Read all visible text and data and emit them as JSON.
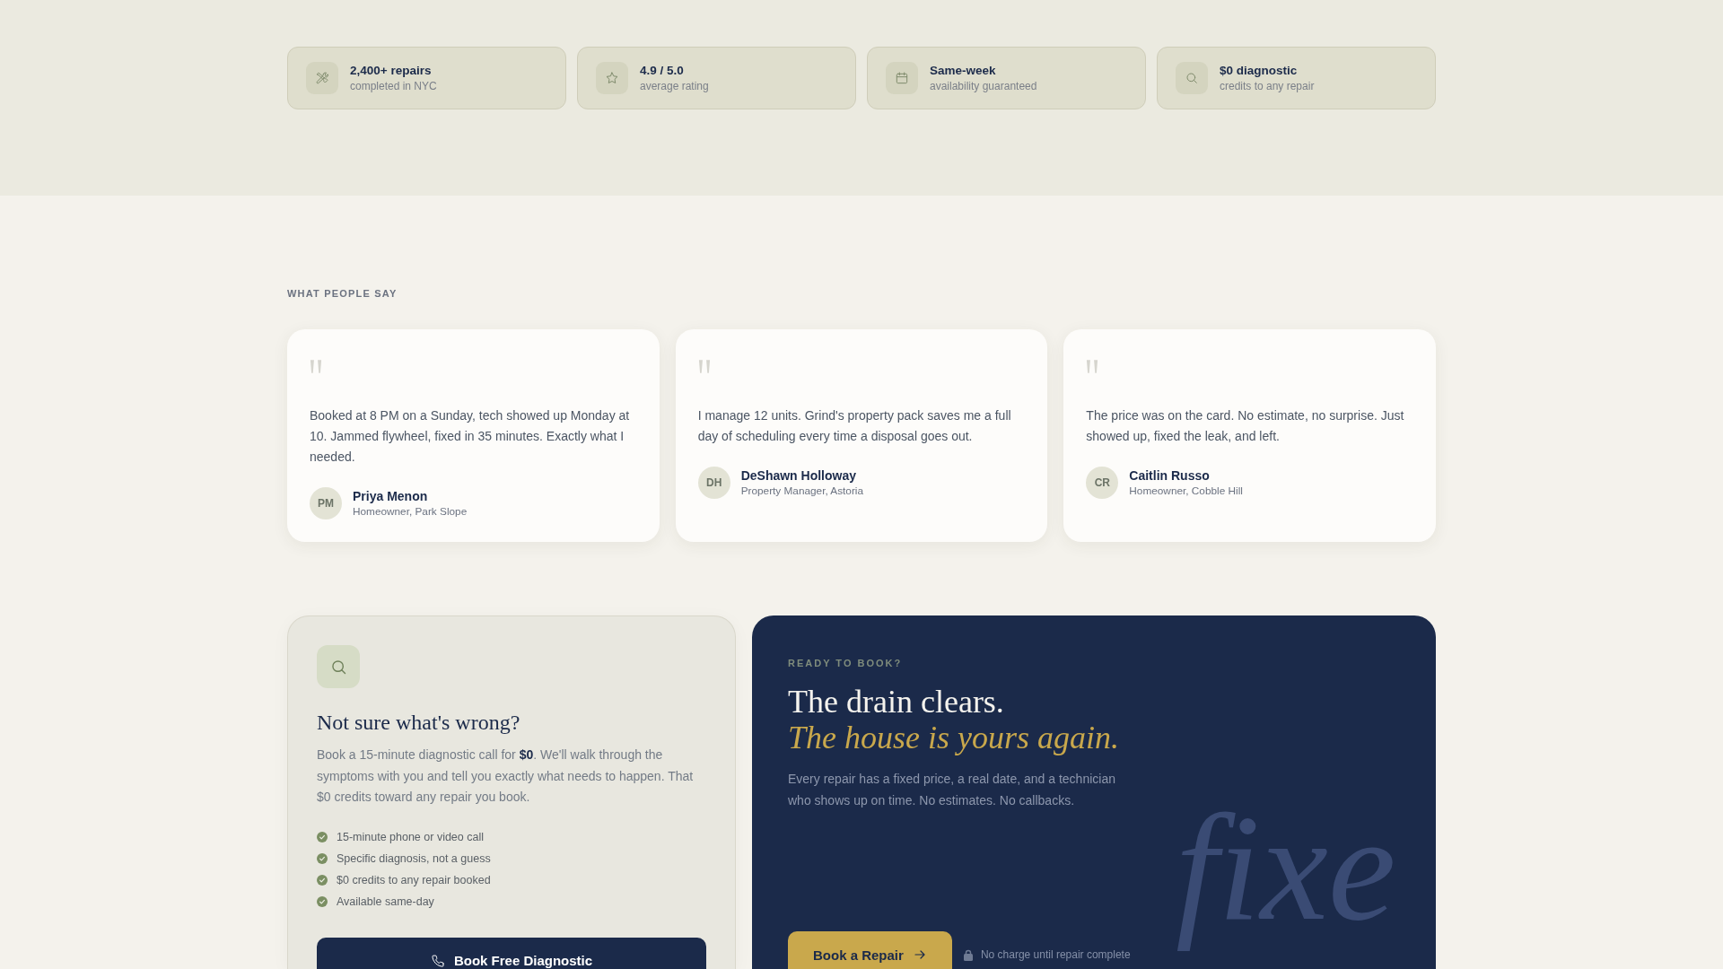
{
  "stats": [
    {
      "title": "2,400+ repairs",
      "caption": "completed in NYC"
    },
    {
      "title": "4.9 / 5.0",
      "caption": "average rating"
    },
    {
      "title": "Same-week",
      "caption": "availability guaranteed"
    },
    {
      "title": "$0 diagnostic",
      "caption": "credits to any repair"
    }
  ],
  "testimonials": {
    "label": "WHAT PEOPLE SAY",
    "items": [
      {
        "quote": "Booked at 8 PM on a Sunday, tech showed up Monday at 10. Jammed flywheel, fixed in 35 minutes. Exactly what I needed.",
        "initials": "PM",
        "name": "Priya Menon",
        "role": "Homeowner, Park Slope"
      },
      {
        "quote": "I manage 12 units. Grind's property pack saves me a full day of scheduling every time a disposal goes out.",
        "initials": "DH",
        "name": "DeShawn Holloway",
        "role": "Property Manager, Astoria"
      },
      {
        "quote": "The price was on the card. No estimate, no surprise. Just showed up, fixed the leak, and left.",
        "initials": "CR",
        "name": "Caitlin Russo",
        "role": "Homeowner, Cobble Hill"
      }
    ]
  },
  "diagnostic_card": {
    "title": "Not sure what's wrong?",
    "description": "Book a 15-minute diagnostic call for **$0**. We'll walk through the symptoms with you and tell you exactly what needs to happen. That $0 credits toward any repair you book.",
    "checklist": [
      "15-minute phone or video call",
      "Specific diagnosis, not a guess",
      "$0 credits to any repair booked",
      "Available same-day"
    ],
    "button": "Book Free Diagnostic"
  },
  "booking_panel": {
    "eyebrow": "READY TO BOOK?",
    "heading": "The drain clears.",
    "heading_accent": "The house is yours again.",
    "description": "Every repair has a fixed price, a real date, and a technician who shows up on time. No estimates. No callbacks.",
    "button": "Book a Repair",
    "note": "No charge until repair complete",
    "background_word": "fixe"
  }
}
